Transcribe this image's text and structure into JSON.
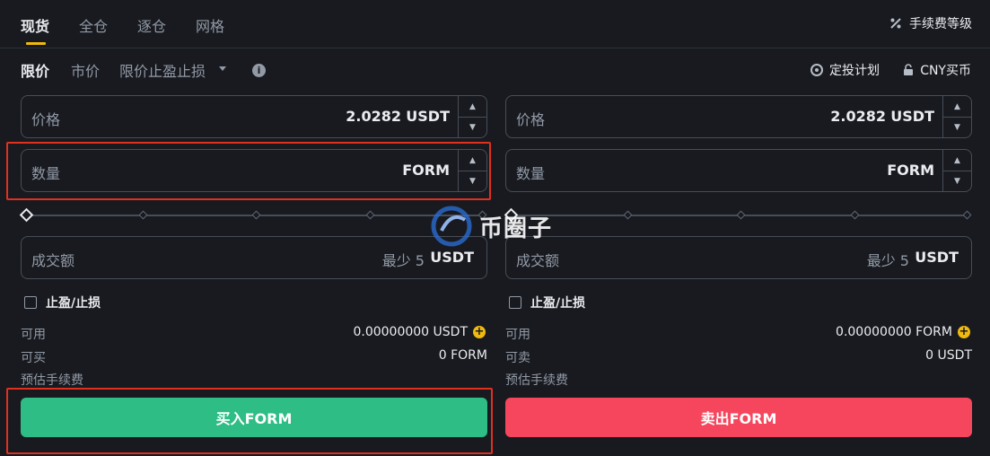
{
  "top_tabs": [
    "现货",
    "全仓",
    "逐仓",
    "网格"
  ],
  "fee_level": "手续费等级",
  "order_types": {
    "limit": "限价",
    "market": "市价",
    "stop_limit": "限价止盈止损",
    "info": "i"
  },
  "links": {
    "dca_plan": "定投计划",
    "cny_buy": "CNY买币"
  },
  "buy": {
    "price_label": "价格",
    "price_value": "2.0282",
    "price_unit": "USDT",
    "qty_label": "数量",
    "qty_unit": "FORM",
    "total_label": "成交额",
    "total_min": "最少 5",
    "total_unit": "USDT",
    "tpsl_label": "止盈/止损",
    "available_label": "可用",
    "available_value": "0.00000000 USDT",
    "can_label": "可买",
    "can_value": "0 FORM",
    "fee_label": "预估手续费",
    "button": "买入FORM"
  },
  "sell": {
    "price_label": "价格",
    "price_value": "2.0282",
    "price_unit": "USDT",
    "qty_label": "数量",
    "qty_unit": "FORM",
    "total_label": "成交额",
    "total_min": "最少 5",
    "total_unit": "USDT",
    "tpsl_label": "止盈/止损",
    "available_label": "可用",
    "available_value": "0.00000000 FORM",
    "can_label": "可卖",
    "can_value": "0 USDT",
    "fee_label": "预估手续费",
    "button": "卖出FORM"
  },
  "watermark": "币圈子",
  "colors": {
    "accent": "#f0b90b",
    "buy": "#2ebd85",
    "sell": "#f6465d",
    "highlight": "#e0301e"
  },
  "icons": [
    "percent-icon",
    "info-icon",
    "caret-down-icon",
    "recurring-icon",
    "lock-icon",
    "plus-icon",
    "stepper-up-icon",
    "stepper-down-icon"
  ]
}
